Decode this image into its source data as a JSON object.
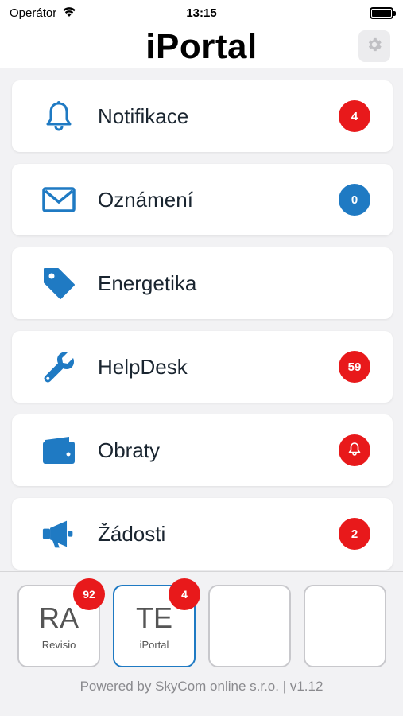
{
  "status_bar": {
    "carrier": "Operátor",
    "time": "13:15",
    "wifi_icon": "wifi-icon",
    "battery_icon": "battery-icon"
  },
  "header": {
    "title": "iPortal",
    "settings_icon": "gear-icon"
  },
  "menu": {
    "items": [
      {
        "label": "Notifikace",
        "icon": "bell-icon",
        "badge": "4",
        "badge_color": "#e8191b"
      },
      {
        "label": "Oznámení",
        "icon": "envelope-icon",
        "badge": "0",
        "badge_color": "#1f7ac3"
      },
      {
        "label": "Energetika",
        "icon": "tag-icon",
        "badge": "",
        "badge_color": ""
      },
      {
        "label": "HelpDesk",
        "icon": "wrench-icon",
        "badge": "59",
        "badge_color": "#e8191b"
      },
      {
        "label": "Obraty",
        "icon": "wallet-icon",
        "badge": "bell-icon",
        "badge_color": "#e8191b"
      },
      {
        "label": "Žádosti",
        "icon": "megaphone-icon",
        "badge": "2",
        "badge_color": "#e8191b"
      }
    ]
  },
  "apps": [
    {
      "abbr": "RA",
      "name": "Revisio",
      "badge": "92",
      "active": false
    },
    {
      "abbr": "TE",
      "name": "iPortal",
      "badge": "4",
      "active": true
    },
    {
      "abbr": "",
      "name": "",
      "badge": "",
      "active": false
    },
    {
      "abbr": "",
      "name": "",
      "badge": "",
      "active": false
    }
  ],
  "footer": {
    "text": "Powered by SkyCom online s.r.o. | v1.12"
  },
  "colors": {
    "accent": "#1f7ac3",
    "badge_red": "#e8191b",
    "background": "#f2f2f4"
  }
}
